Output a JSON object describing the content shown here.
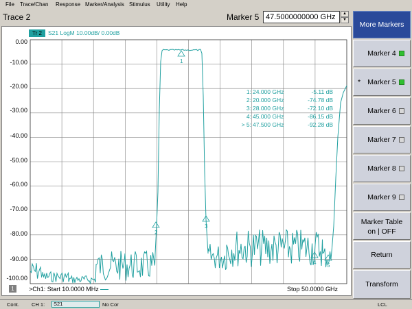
{
  "menu": [
    "File",
    "Trace/Chan",
    "Response",
    "Marker/Analysis",
    "Stimulus",
    "Utility",
    "Help"
  ],
  "header": {
    "trace_title": "Trace 2",
    "marker_label": "Marker 5",
    "marker_value": "47.5000000000 GHz",
    "spin_up": "▲",
    "spin_down": "▼"
  },
  "trace": {
    "badge": "Tr 2",
    "info": "S21 LogM 10.00dB/  0.00dB",
    "color": "#20a0a0"
  },
  "y_labels": [
    "0.00",
    "-10.00",
    "-20.00",
    "-30.00",
    "-40.00",
    "-50.00",
    "-60.00",
    "-70.00",
    "-80.00",
    "-90.00",
    "-100.00"
  ],
  "marker_table": [
    {
      "id": "1:",
      "freq": "24.000 GHz",
      "val": "-5.11 dB"
    },
    {
      "id": "2:",
      "freq": "20.000 GHz",
      "val": "-74.78 dB"
    },
    {
      "id": "3:",
      "freq": "28.000 GHz",
      "val": "-72.10 dB"
    },
    {
      "id": "4:",
      "freq": "45.000 GHz",
      "val": "-86.15 dB"
    },
    {
      "id": "> 5:",
      "freq": "47.500 GHz",
      "val": "-92.28 dB"
    }
  ],
  "marker_flags": [
    "1",
    "2",
    "3",
    "4",
    "5"
  ],
  "bottom": {
    "ch_num": "1",
    "start": ">Ch1: Start  10.0000 MHz",
    "stop": "Stop  50.0000 GHz"
  },
  "status": {
    "cont": "Cont.",
    "ch": "CH 1:",
    "param": "S21",
    "cor": "No Cor",
    "lcl": "LCL"
  },
  "softkeys": [
    {
      "label": "More Markers",
      "active": true
    },
    {
      "label": "Marker 4",
      "led": "on"
    },
    {
      "label": "Marker 5",
      "led": "on",
      "star": "*"
    },
    {
      "label": "Marker 6",
      "led": "off"
    },
    {
      "label": "Marker 7",
      "led": "off"
    },
    {
      "label": "Marker 8",
      "led": "off"
    },
    {
      "label": "Marker 9",
      "led": "off"
    },
    {
      "line1": "Marker Table",
      "line2": "on | OFF"
    },
    {
      "label": "Return"
    },
    {
      "label": "Transform"
    }
  ]
}
